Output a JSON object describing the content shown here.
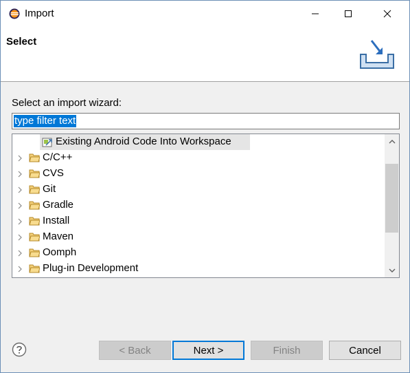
{
  "window": {
    "title": "Import",
    "controls": [
      "minimize-icon",
      "maximize-icon",
      "close-icon"
    ]
  },
  "banner": {
    "title": "Select",
    "icon": "import-wizard-icon"
  },
  "body": {
    "prompt": "Select an import wizard:",
    "filter": {
      "value": "type filter text",
      "selected": true
    }
  },
  "tree": {
    "items": [
      {
        "label": "Existing Android Code Into Workspace",
        "icon": "android-project-icon",
        "highlighted": true
      },
      {
        "label": "C/C++",
        "icon": "folder-icon"
      },
      {
        "label": "CVS",
        "icon": "folder-icon"
      },
      {
        "label": "Git",
        "icon": "folder-icon"
      },
      {
        "label": "Gradle",
        "icon": "folder-icon"
      },
      {
        "label": "Install",
        "icon": "folder-icon"
      },
      {
        "label": "Maven",
        "icon": "folder-icon"
      },
      {
        "label": "Oomph",
        "icon": "folder-icon"
      },
      {
        "label": "Plug-in Development",
        "icon": "folder-icon"
      }
    ]
  },
  "footer": {
    "help_icon": "help-icon",
    "back_label": "< Back",
    "next_label": "Next >",
    "finish_label": "Finish",
    "cancel_label": "Cancel"
  },
  "colors": {
    "accent": "#0078d7",
    "selection_bg": "#0078d7",
    "highlight_row": "#e5e5e5",
    "folder": "#dcb35c"
  }
}
